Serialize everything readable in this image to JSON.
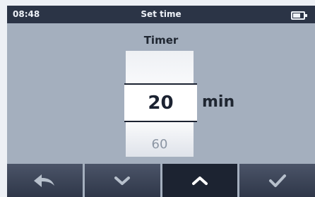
{
  "status_bar": {
    "time": "08:48",
    "title": "Set time",
    "battery_icon": "battery-icon"
  },
  "main": {
    "heading": "Timer",
    "selected_value": "20",
    "next_value": "60",
    "unit": "min"
  },
  "softkeys": [
    {
      "icon": "back-arrow-icon"
    },
    {
      "icon": "chevron-down-icon"
    },
    {
      "icon": "chevron-up-icon",
      "active": true
    },
    {
      "icon": "checkmark-icon"
    }
  ],
  "colors": {
    "status_bg": "#2b3446",
    "screen_bg": "#a4afbe",
    "softkey_bg": "#3f4759",
    "softkey_active_bg": "#1c2331",
    "text_dark": "#1b2231",
    "text_muted": "#8b95a3"
  }
}
